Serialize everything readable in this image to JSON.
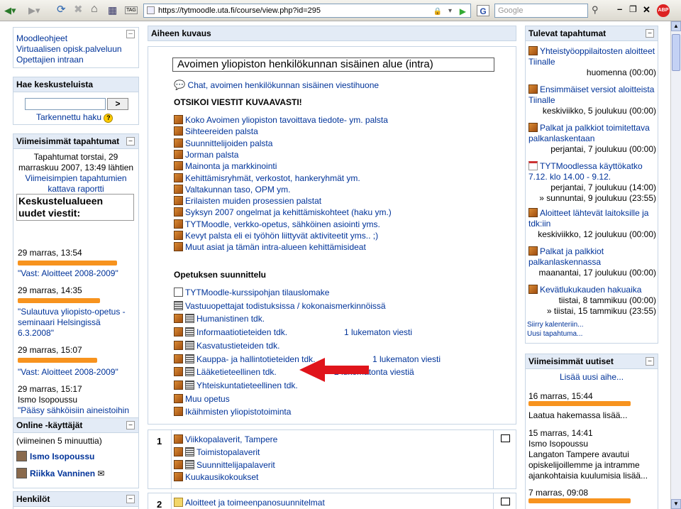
{
  "browser": {
    "url": "https://tytmoodle.uta.fi/course/view.php?id=295",
    "search_placeholder": "Google",
    "tag_label": "TAG"
  },
  "left": {
    "links": [
      "Moodleohjeet",
      "Virtuaalisen opisk.palveluun",
      "Opettajien intraan"
    ],
    "search": {
      "title": "Hae keskusteluista",
      "go": ">",
      "advanced": "Tarkennettu haku"
    },
    "recent": {
      "title": "Viimeisimmät tapahtumat",
      "since": "Tapahtumat torstai, 29 marraskuu 2007, 13:49 lähtien",
      "full_report": "Viimeisimpien tapahtumien kattava raportti",
      "heading": "Keskustelualueen uudet viestit:",
      "items": [
        {
          "time": "29 marras, 13:54",
          "subject": "\"Vast: Aloitteet 2008-2009\""
        },
        {
          "time": "29 marras, 14:35",
          "subject": "\"Sulautuva yliopisto-opetus -seminaari Helsingissä 6.3.2008\""
        },
        {
          "time": "29 marras, 15:07",
          "subject": "\"Vast: Aloitteet 2008-2009\""
        },
        {
          "time": "29 marras, 15:17",
          "author": "Ismo Isopoussu",
          "subject": "\"Pääsy sähköisiin aineistoihin toteutumassa myös teknisesti\""
        }
      ]
    },
    "online": {
      "title": "Online -käyttäjät",
      "period": "(viimeinen 5 minuuttia)",
      "users": [
        "Ismo Isopoussu",
        "Riikka Vanninen"
      ]
    },
    "people": {
      "title": "Henkilöt"
    }
  },
  "main": {
    "header": "Aiheen kuvaus",
    "title": "Avoimen yliopiston henkilökunnan sisäinen alue (intra)",
    "chat": "Chat, avoimen henkilökunnan sisäinen viestihuone",
    "notice": "OTSIKOI VIESTIT KUVAAVASTI!",
    "forums": [
      "Koko Avoimen yliopiston tavoittava tiedote- ym. palsta",
      "Sihteereiden palsta",
      "Suunnittelijoiden palsta",
      "Jorman palsta",
      "Mainonta ja markkinointi",
      "Kehittämisryhmät, verkostot, hankeryhmät ym.",
      "Valtakunnan taso, OPM ym.",
      "Erilaisten muiden prosessien palstat",
      "Syksyn 2007 ongelmat ja kehittämiskohteet (haku ym.)",
      "TYTMoodle, verkko-opetus, sähköinen asiointi yms.",
      "Kevyt palsta eli ei työhön liittyvät aktiviteetit yms.. ;)",
      "Muut asiat ja tämän intra-alueen kehittämisideat"
    ],
    "planning_heading": "Opetuksen suunnittelu",
    "planning": [
      {
        "label": "TYTMoodle-kurssipohjan tilauslomake",
        "icon": "doc"
      },
      {
        "label": "Vastuuopettajat todistuksissa / kokonaismerkinnöissä",
        "icon": "res"
      },
      {
        "label": "Humanistinen tdk.",
        "icon": "both"
      },
      {
        "label": "Informaatiotieteiden tdk.",
        "icon": "both",
        "unread": "1 lukematon viesti"
      },
      {
        "label": "Kasvatustieteiden tdk.",
        "icon": "both"
      },
      {
        "label": "Kauppa- ja hallintotieteiden tdk.",
        "icon": "both",
        "unread": "1 lukematon viesti"
      },
      {
        "label": "Lääketieteellinen tdk.",
        "icon": "both",
        "unread": "2 lukematonta viestiä"
      },
      {
        "label": "Yhteiskuntatieteellinen tdk.",
        "icon": "both"
      },
      {
        "label": "Muu opetus",
        "icon": "forum"
      },
      {
        "label": "Ikäihmisten yliopistotoiminta",
        "icon": "forum"
      }
    ],
    "section1": {
      "num": "1",
      "items": [
        {
          "label": "Viikkopalaverit, Tampere",
          "icon": "forum"
        },
        {
          "label": "Toimistopalaverit",
          "icon": "both"
        },
        {
          "label": "Suunnittelijapalaverit",
          "icon": "both"
        },
        {
          "label": "Kuukausikokoukset",
          "icon": "forum"
        }
      ]
    },
    "section2": {
      "num": "2",
      "items": [
        {
          "label": "Aloitteet ja toimeenpanosuunnitelmat",
          "icon": "fold"
        }
      ]
    }
  },
  "right": {
    "upcoming": {
      "title": "Tulevat tapahtumat",
      "events": [
        {
          "title": "Yhteistyöoppilaitosten aloitteet Tiinalle",
          "date": "huomenna",
          "time": "(00:00)",
          "icon": "forum"
        },
        {
          "title": "Ensimmäiset versiot aloitteista Tiinalle",
          "date": "keskiviikko, 5 joulukuu",
          "time": "(00:00)",
          "icon": "forum"
        },
        {
          "title": "Palkat ja palkkiot toimitettava palkanlaskentaan",
          "date": "perjantai, 7 joulukuu",
          "time": "(00:00)",
          "icon": "forum"
        },
        {
          "title": "TYTMoodlessa käyttökatko 7.12. klo 14.00 - 9.12.",
          "date": "perjantai, 7 joulukuu",
          "time": "(14:00)",
          "date2": "» sunnuntai, 9 joulukuu",
          "time2": "(23:55)",
          "icon": "cal"
        },
        {
          "title": "Aloitteet lähtevät laitoksille ja tdk:iin",
          "date": "keskiviikko, 12 joulukuu",
          "time": "(00:00)",
          "icon": "forum"
        },
        {
          "title": "Palkat ja palkkiot palkanlaskennassa",
          "date": "maanantai, 17 joulukuu",
          "time": "(00:00)",
          "icon": "forum"
        },
        {
          "title": "Kevätlukukauden hakuaika",
          "date": "tiistai, 8 tammikuu",
          "time": "(00:00)",
          "date2": "» tiistai, 15 tammikuu",
          "time2": "(23:55)",
          "icon": "forum"
        }
      ],
      "goto_calendar": "Siirry kalenteriin...",
      "new_event": "Uusi tapahtuma..."
    },
    "news": {
      "title": "Viimeisimmät uutiset",
      "add": "Lisää uusi aihe...",
      "items": [
        {
          "time": "16 marras, 15:44",
          "text": "Laatua hakemassa lisää..."
        },
        {
          "time": "15 marras, 14:41",
          "author": "Ismo Isopoussu",
          "text": "Langaton Tampere avautui opiskelijoillemme ja intramme ajankohtaisia kuulumisia lisää..."
        },
        {
          "time": "7 marras, 09:08"
        }
      ]
    }
  },
  "colors": {
    "block_header": "#e3ebf6",
    "border": "#c7d5e4",
    "link": "#003399",
    "highlight": "#f7931e",
    "arrow": "#e0141b"
  }
}
